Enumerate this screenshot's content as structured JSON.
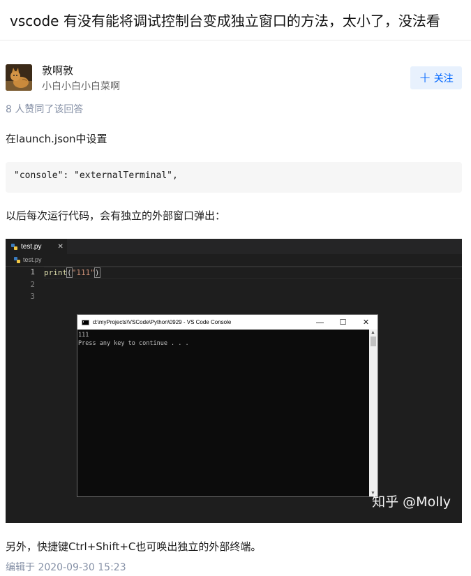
{
  "question": {
    "title": "vscode 有没有能将调试控制台变成独立窗口的方法，太小了，没法看"
  },
  "author": {
    "name": "敦啊敦",
    "bio": "小白小白小白菜啊",
    "avatar_icon": "cat-avatar"
  },
  "follow": {
    "icon": "plus-icon",
    "label": "关注"
  },
  "votes_text": "8 人赞同了该回答",
  "answer": {
    "para1": "在launch.json中设置",
    "code": "\"console\": \"externalTerminal\",",
    "para2": "以后每次运行代码，会有独立的外部窗口弹出：",
    "para3": "另外，快捷键Ctrl+Shift+C也可唤出独立的外部终端。"
  },
  "screenshot": {
    "tab_label": "test.py",
    "tab_close": "✕",
    "breadcrumb": "test.py",
    "line_numbers": [
      "1",
      "2",
      "3"
    ],
    "code_fn": "print",
    "code_open": "(",
    "code_str": "\"111\"",
    "code_close": ")",
    "console_title": "d:\\myProjects\\VSCode\\Python\\0929 - VS Code Console",
    "minimize": "—",
    "maximize": "☐",
    "close": "✕",
    "console_lines": [
      "111",
      "Press any key to continue . . ."
    ],
    "watermark": "知乎 @Molly"
  },
  "edit_time": "编辑于 2020-09-30 15:23",
  "colors": {
    "accent": "#0066ff",
    "follow_bg": "#e8f1fd",
    "meta_gray": "#8590a6"
  }
}
